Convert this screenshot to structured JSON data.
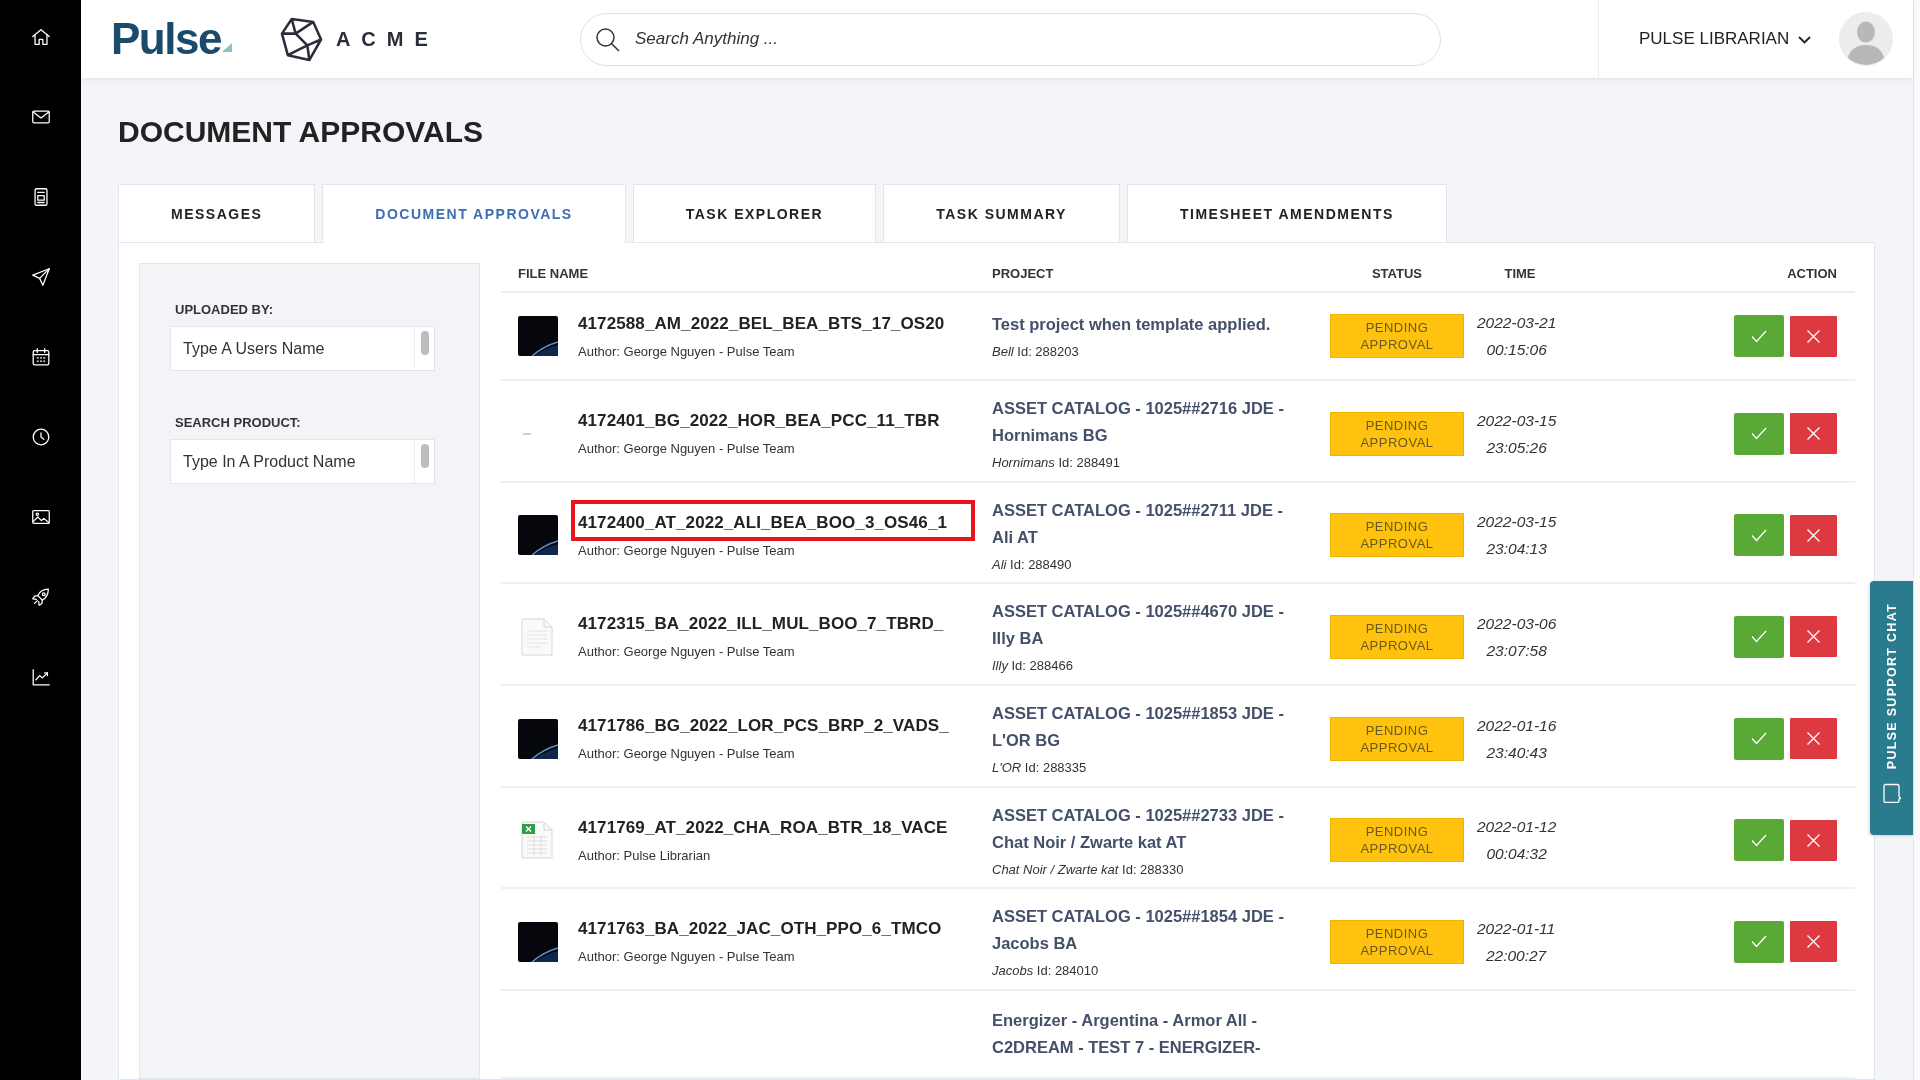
{
  "header": {
    "logo": "Pulse",
    "brand": "ACME",
    "search": {
      "placeholder": "Search Anything ..."
    },
    "user": {
      "name": "PULSE LIBRARIAN"
    }
  },
  "page_title": "DOCUMENT APPROVALS",
  "tabs": [
    {
      "label": "MESSAGES",
      "selected": false
    },
    {
      "label": "DOCUMENT APPROVALS",
      "selected": true
    },
    {
      "label": "TASK EXPLORER",
      "selected": false
    },
    {
      "label": "TASK SUMMARY",
      "selected": false
    },
    {
      "label": "TIMESHEET AMENDMENTS",
      "selected": false
    }
  ],
  "filters": [
    {
      "label": "UPLOADED BY:",
      "placeholder": "Type A Users Name"
    },
    {
      "label": "SEARCH PRODUCT:",
      "placeholder": "Type In A Product Name"
    }
  ],
  "table": {
    "columns": [
      "FILE NAME",
      "PROJECT",
      "STATUS",
      "TIME",
      "ACTION"
    ],
    "rows": [
      {
        "thumbnail": {
          "kind": "photo"
        },
        "file_name": "4172588_AM_2022_BEL_BEA_BTS_17_OS20",
        "author": "Author: George Nguyen - Pulse Team",
        "highlighted": false,
        "project": "Test project when template applied.",
        "project_id": "*Bell* Id: 288203",
        "status": "PENDING APPROVAL",
        "date": "2022-03-21",
        "time": "00:15:06"
      },
      {
        "thumbnail": {
          "kind": "blank"
        },
        "file_name": "4172401_BG_2022_HOR_BEA_PCC_11_TBR",
        "author": "Author: George Nguyen - Pulse Team",
        "highlighted": false,
        "project": "ASSET CATALOG - 1025##2716 JDE - Hornimans BG",
        "project_id": "*Hornimans* Id: 288491",
        "status": "PENDING APPROVAL",
        "date": "2022-03-15",
        "time": "23:05:26"
      },
      {
        "thumbnail": {
          "kind": "photo"
        },
        "file_name": "4172400_AT_2022_ALI_BEA_BOO_3_OS46_1",
        "author": "Author: George Nguyen - Pulse Team",
        "highlighted": true,
        "project": "ASSET CATALOG - 1025##2711 JDE - Ali AT",
        "project_id": "*Ali* Id: 288490",
        "status": "PENDING APPROVAL",
        "date": "2022-03-15",
        "time": "23:04:13"
      },
      {
        "thumbnail": {
          "kind": "document"
        },
        "file_name": "4172315_BA_2022_ILL_MUL_BOO_7_TBRD_",
        "author": "Author: George Nguyen - Pulse Team",
        "highlighted": false,
        "project": "ASSET CATALOG - 1025##4670 JDE - Illy BA",
        "project_id": "*Illy* Id: 288466",
        "status": "PENDING APPROVAL",
        "date": "2022-03-06",
        "time": "23:07:58"
      },
      {
        "thumbnail": {
          "kind": "photo"
        },
        "file_name": "4171786_BG_2022_LOR_PCS_BRP_2_VADS_",
        "author": "Author: George Nguyen - Pulse Team",
        "highlighted": false,
        "project": "ASSET CATALOG - 1025##1853 JDE - L'OR BG",
        "project_id": "*L'OR* Id: 288335",
        "status": "PENDING APPROVAL",
        "date": "2022-01-16",
        "time": "23:40:43"
      },
      {
        "thumbnail": {
          "kind": "spreadsheet"
        },
        "file_name": "4171769_AT_2022_CHA_ROA_BTR_18_VACE",
        "author": "Author: Pulse Librarian",
        "highlighted": false,
        "project": "ASSET CATALOG - 1025##2733 JDE - Chat Noir / Zwarte kat AT",
        "project_id": "*Chat Noir / Zwarte kat* Id: 288330",
        "status": "PENDING APPROVAL",
        "date": "2022-01-12",
        "time": "00:04:32"
      },
      {
        "thumbnail": {
          "kind": "photo"
        },
        "file_name": "4171763_BA_2022_JAC_OTH_PPO_6_TMCO",
        "author": "Author: George Nguyen - Pulse Team",
        "highlighted": false,
        "project": "ASSET CATALOG - 1025##1854 JDE - Jacobs BA",
        "project_id": "*Jacobs* Id: 284010",
        "status": "PENDING APPROVAL",
        "date": "2022-01-11",
        "time": "22:00:27"
      },
      {
        "project": "Energizer - Argentina - Armor All - C2DREAM - TEST 7 - ENERGIZER-"
      }
    ]
  },
  "support_chat": {
    "label": "PULSE SUPPORT CHAT"
  }
}
